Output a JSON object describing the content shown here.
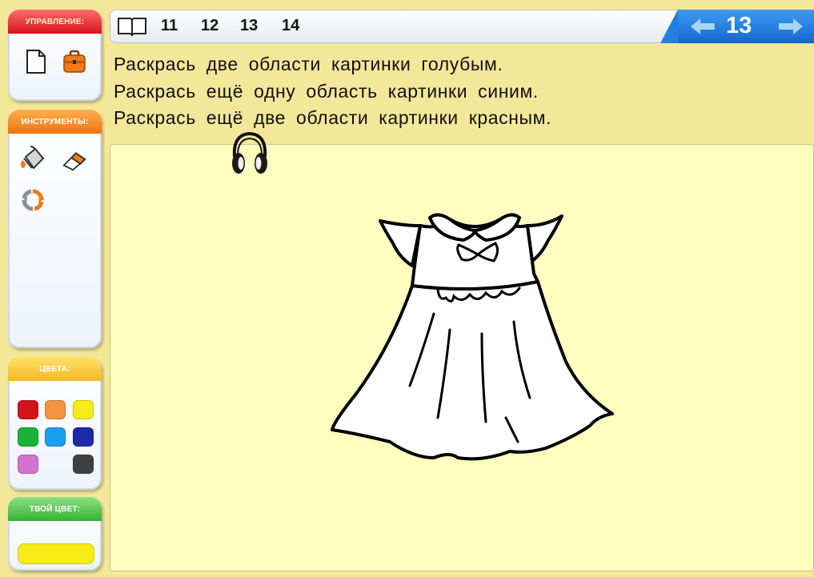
{
  "sidebar": {
    "control": {
      "title": "УПРАВЛЕНИЕ:",
      "buttons": [
        "new-document",
        "briefcase"
      ]
    },
    "tools": {
      "title": "ИНСТРУМЕНТЫ:",
      "buttons": [
        "paint-bucket",
        "eraser",
        "refresh"
      ]
    },
    "colors": {
      "title": "ЦВЕТА:",
      "swatches": [
        "#d0141a",
        "#f29541",
        "#f7ec18",
        "#19b23a",
        "#1a9ef0",
        "#1c2aa8",
        "#d274cf",
        "#404040"
      ]
    },
    "my_color": {
      "title": "ТВОЙ ЦВЕТ:",
      "value": "#f7ec18"
    }
  },
  "topbar": {
    "pages": [
      "11",
      "12",
      "13",
      "14"
    ],
    "current_page": "13",
    "accent": "#1a7ae0"
  },
  "instructions": [
    "Раскрась две области картинки голубым.",
    "Раскрась ещё одну область картинки синим.",
    "Раскрась ещё две области картинки красным."
  ],
  "audio_icon": "headphones-icon",
  "picture": "dress-outline"
}
